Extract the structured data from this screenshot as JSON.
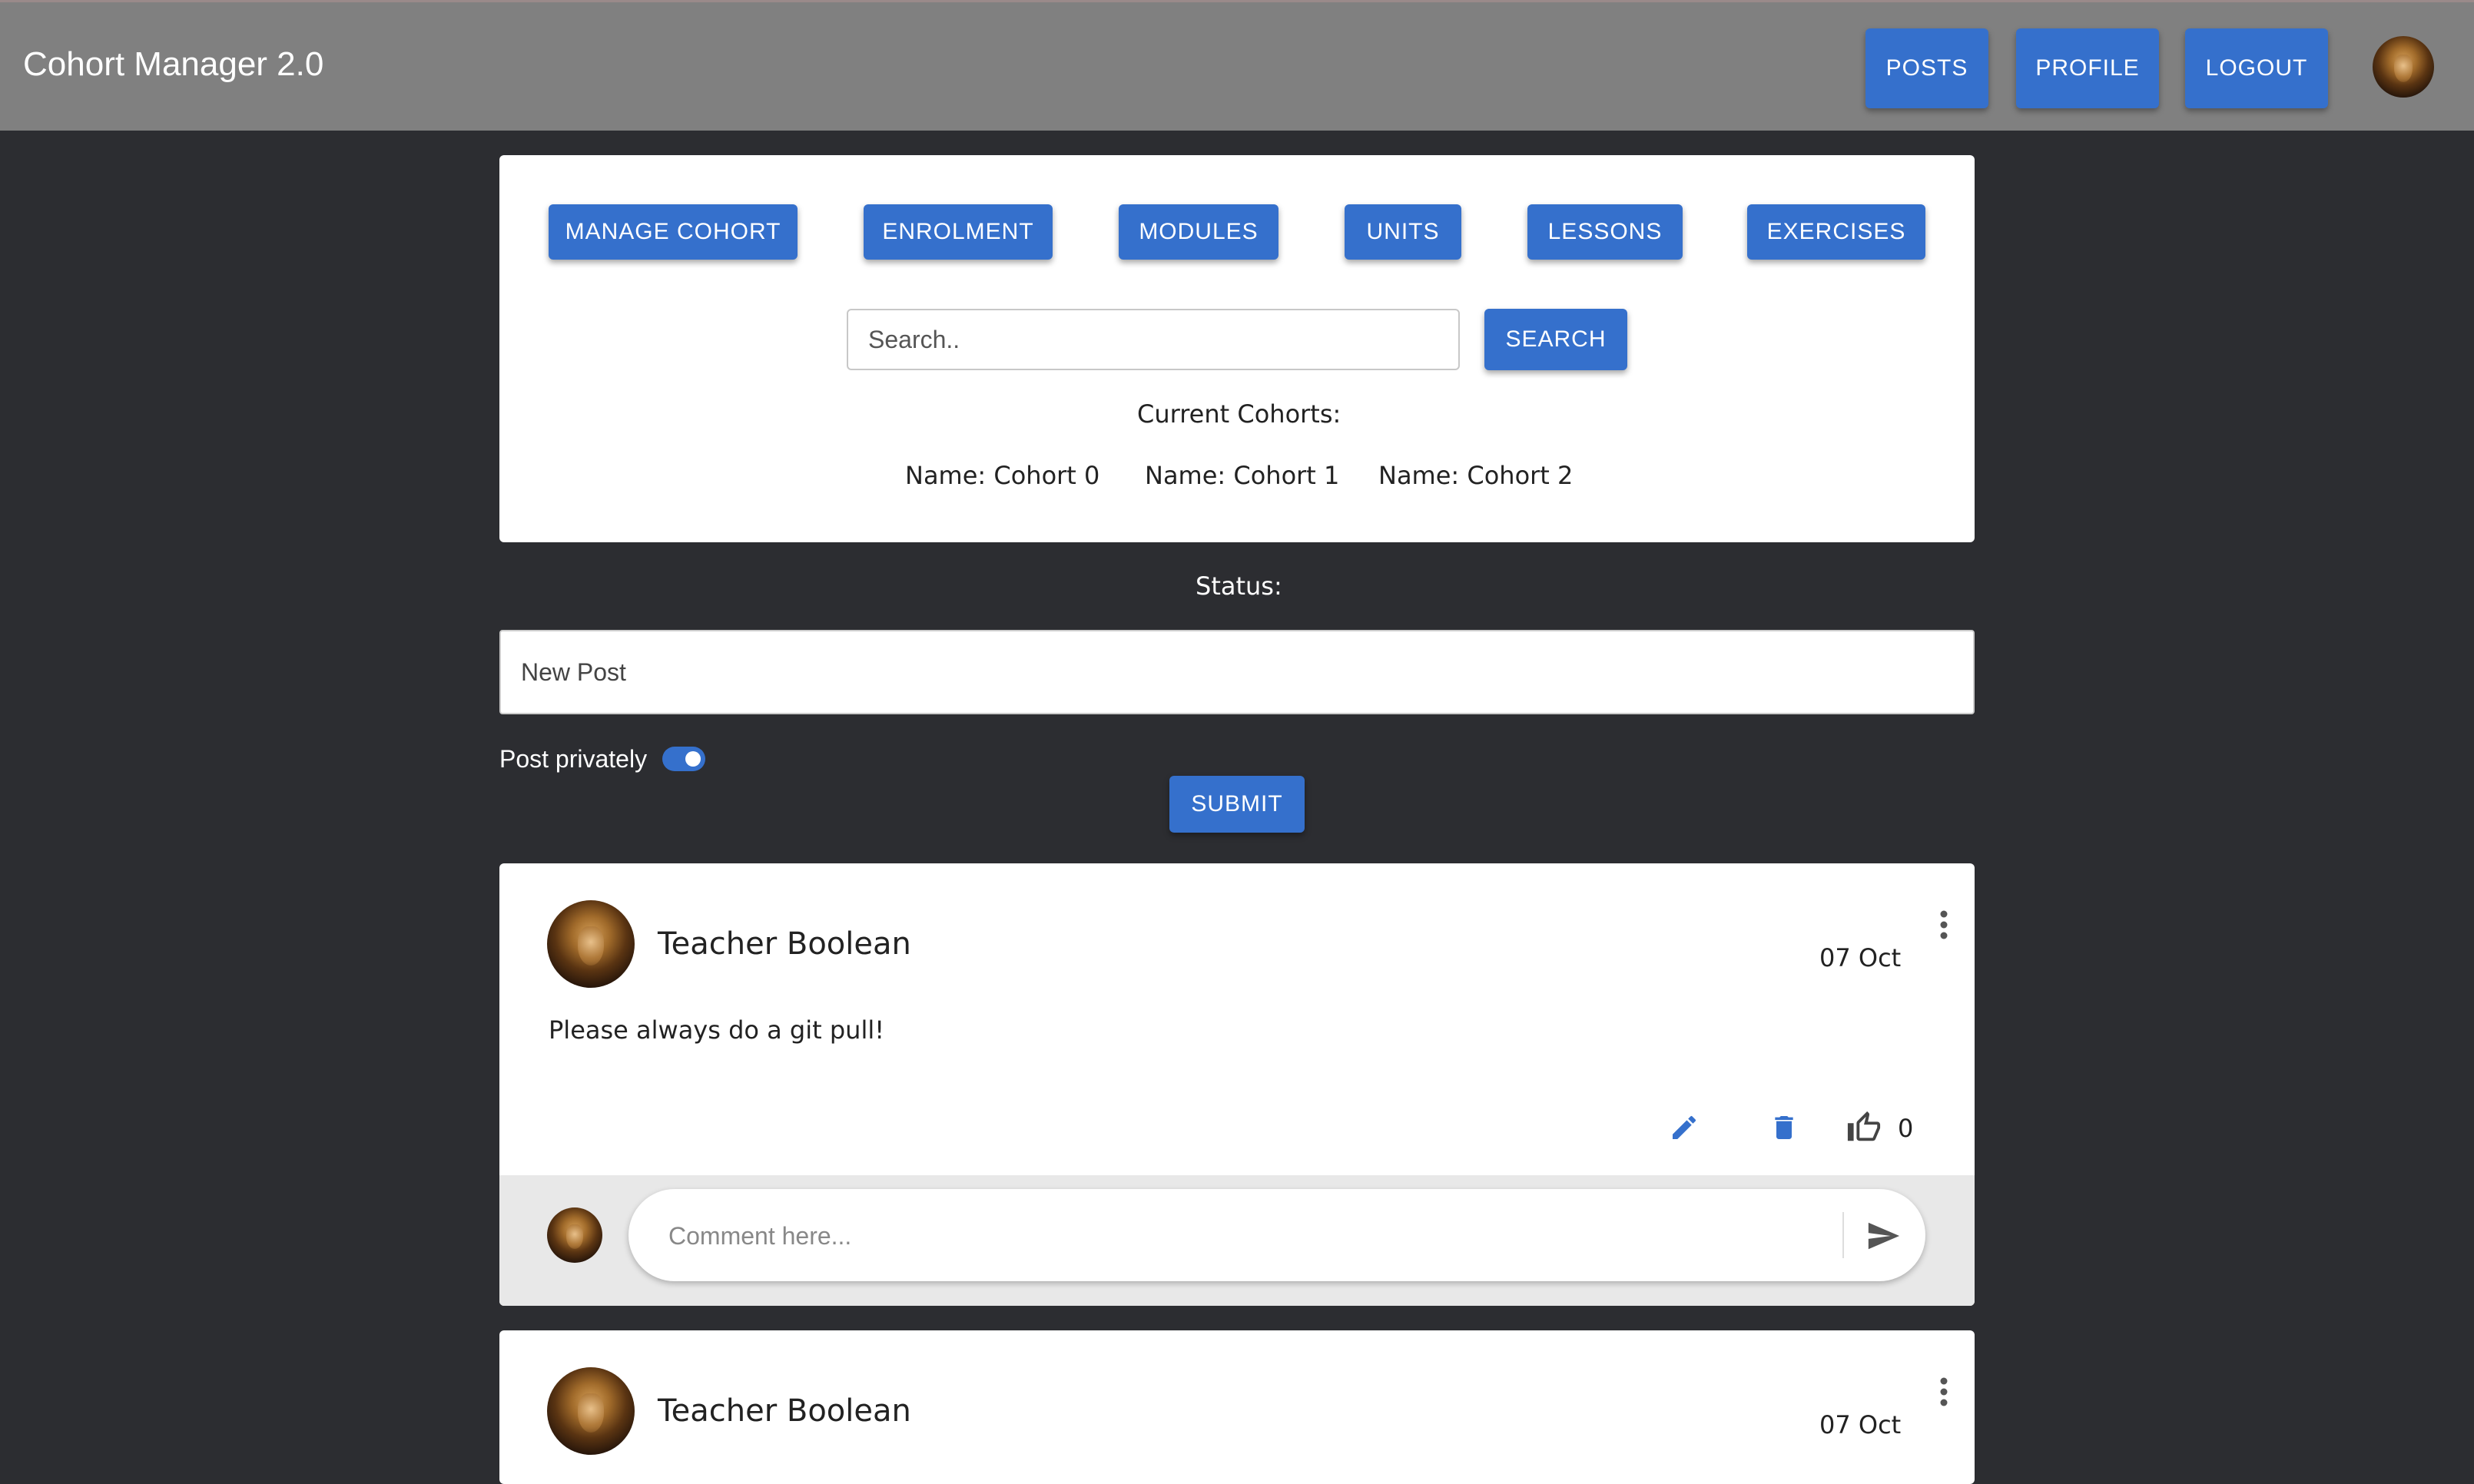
{
  "app": {
    "title": "Cohort Manager 2.0"
  },
  "nav": {
    "posts": "POSTS",
    "profile": "PROFILE",
    "logout": "LOGOUT"
  },
  "admin": {
    "buttons": [
      "MANAGE COHORT",
      "ENROLMENT",
      "MODULES",
      "UNITS",
      "LESSONS",
      "EXERCISES"
    ],
    "search_placeholder": "Search..",
    "search_button": "SEARCH",
    "current_cohorts_label": "Current Cohorts:",
    "cohorts": [
      "Name: Cohort 0",
      "Name: Cohort 1",
      "Name: Cohort 2"
    ]
  },
  "status": {
    "label": "Status:",
    "new_post_placeholder": "New Post",
    "post_privately_label": "Post privately",
    "post_privately": true,
    "submit": "SUBMIT"
  },
  "posts": [
    {
      "author": "Teacher Boolean",
      "date": "07 Oct",
      "content": "Please always do a git pull!",
      "likes": "0",
      "comment_placeholder": "Comment here..."
    },
    {
      "author": "Teacher Boolean",
      "date": "07 Oct"
    }
  ],
  "colors": {
    "primary": "#3570cc",
    "topbar": "#808080",
    "background": "#2c2d31"
  },
  "icons": [
    "avatar",
    "edit-icon",
    "delete-icon",
    "thumb-up-icon",
    "more-vert-icon",
    "send-icon"
  ]
}
